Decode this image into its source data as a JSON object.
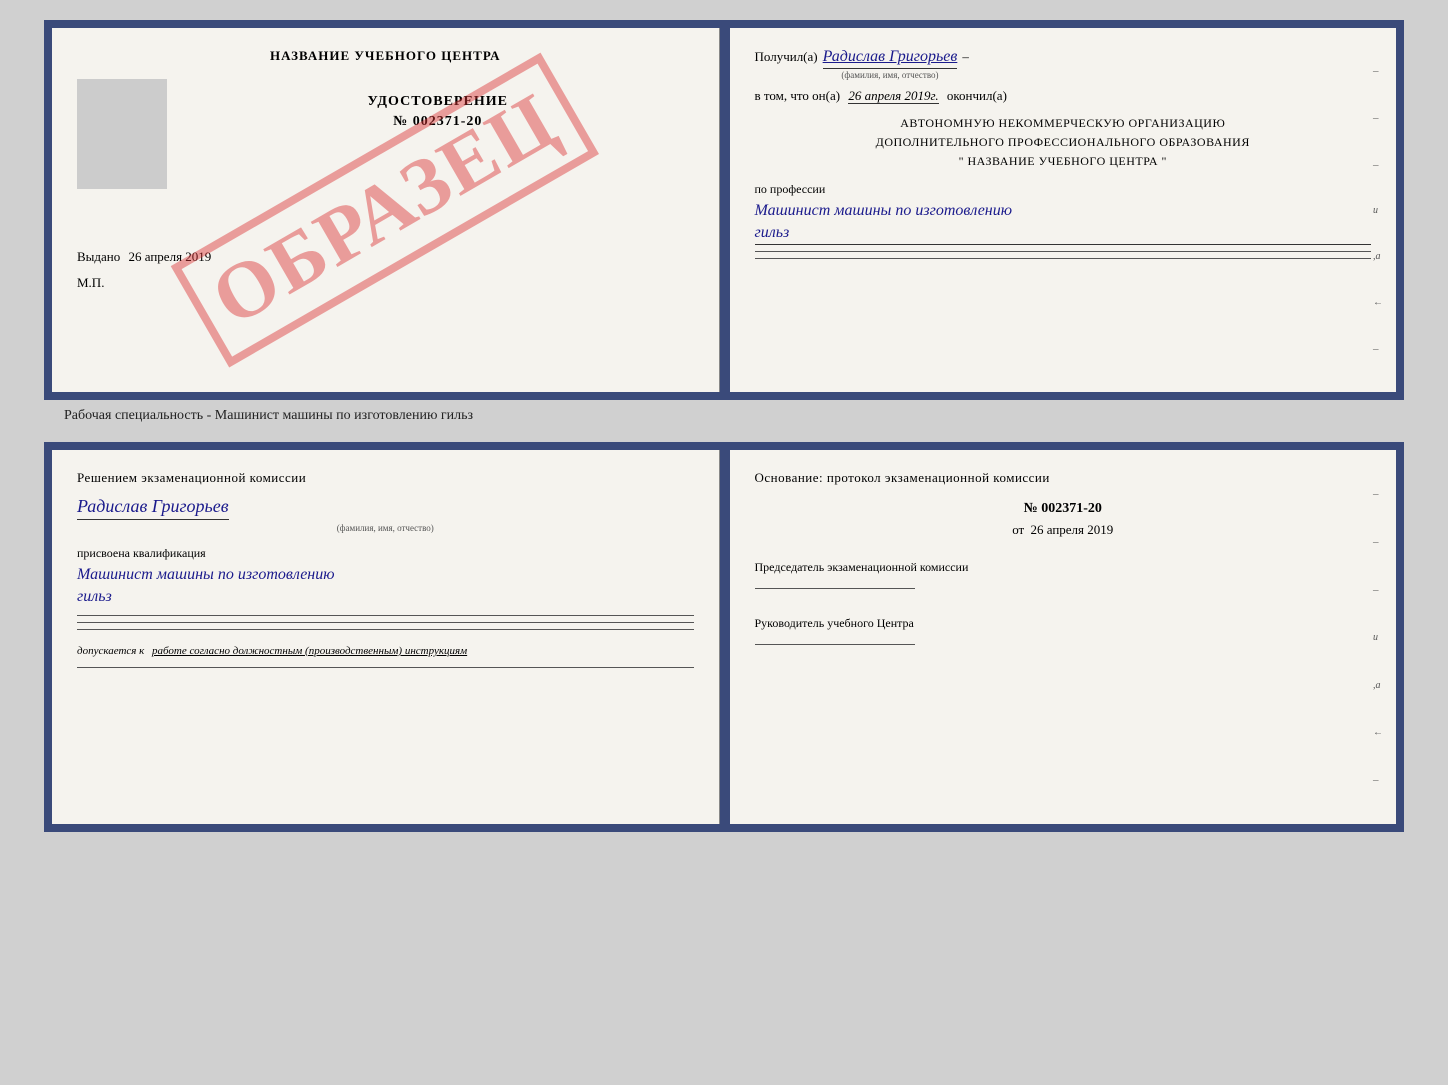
{
  "top_document": {
    "left_page": {
      "center_title": "НАЗВАНИЕ УЧЕБНОГО ЦЕНТРА",
      "cert_title": "УДОСТОВЕРЕНИЕ",
      "cert_number": "№ 002371-20",
      "issued_label": "Выдано",
      "issued_date": "26 апреля 2019",
      "mp_label": "М.П.",
      "watermark": "ОБРАЗЕЦ"
    },
    "right_page": {
      "received_label": "Получил(а)",
      "recipient_name": "Радислав Григорьев",
      "name_sublabel": "(фамилия, имя, отчество)",
      "in_that_label": "в том, что он(а)",
      "completion_date": "26 апреля 2019г.",
      "finished_label": "окончил(а)",
      "org_line1": "АВТОНОМНУЮ НЕКОММЕРЧЕСКУЮ ОРГАНИЗАЦИЮ",
      "org_line2": "ДОПОЛНИТЕЛЬНОГО ПРОФЕССИОНАЛЬНОГО ОБРАЗОВАНИЯ",
      "org_line3": "\" НАЗВАНИЕ УЧЕБНОГО ЦЕНТРА \"",
      "profession_label": "по профессии",
      "profession_name": "Машинист машины по изготовлению",
      "profession_name2": "гильз",
      "side_dashes": [
        "–",
        "–",
        "–",
        "–",
        "–",
        "–",
        "–"
      ]
    }
  },
  "specialty_label": "Рабочая специальность - Машинист машины по изготовлению гильз",
  "bottom_document": {
    "left_page": {
      "commission_title": "Решением  экзаменационной  комиссии",
      "person_name": "Радислав Григорьев",
      "name_sublabel": "(фамилия, имя, отчество)",
      "qualification_label": "присвоена квалификация",
      "qualification_name": "Машинист машины по изготовлению",
      "qualification_name2": "гильз",
      "allowed_label": "допускается к",
      "allowed_text": "работе согласно должностным (производственным) инструкциям"
    },
    "right_page": {
      "basis_title": "Основание: протокол экзаменационной  комиссии",
      "protocol_number": "№  002371-20",
      "date_label": "от",
      "protocol_date": "26 апреля 2019",
      "chairman_label": "Председатель экзаменационной комиссии",
      "director_label": "Руководитель учебного Центра",
      "side_dashes": [
        "–",
        "–",
        "–",
        "–",
        "–",
        "–",
        "–"
      ]
    }
  }
}
